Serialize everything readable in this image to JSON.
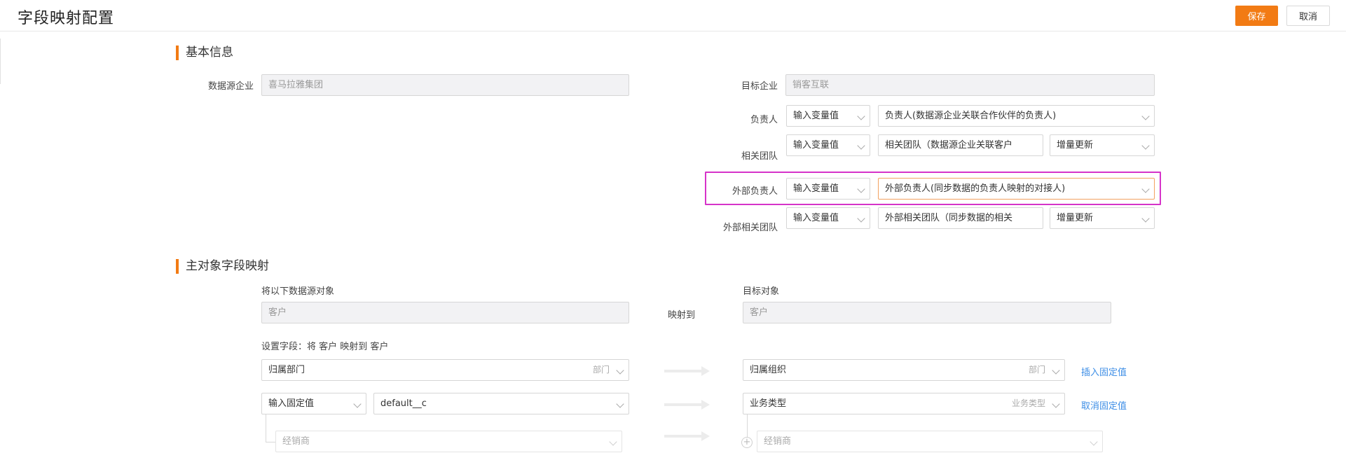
{
  "header": {
    "title": "字段映射配置",
    "save_label": "保存",
    "cancel_label": "取消"
  },
  "basic_info": {
    "section_title": "基本信息",
    "source_company_label": "数据源企业",
    "source_company_value": "喜马拉雅集团",
    "target_company_label": "目标企业",
    "target_company_value": "销客互联",
    "rows": [
      {
        "label": "负责人",
        "mode": "输入变量值",
        "value": "负责人(数据源企业关联合作伙伴的负责人)"
      },
      {
        "label": "相关团队",
        "mode": "输入变量值",
        "value": "相关团队（数据源企业关联客户",
        "update": "增量更新"
      },
      {
        "label": "外部负责人",
        "mode": "输入变量值",
        "value": "外部负责人(同步数据的负责人映射的对接人)"
      },
      {
        "label": "外部相关团队",
        "mode": "输入变量值",
        "value": "外部相关团队（同步数据的相关",
        "update": "增量更新"
      }
    ]
  },
  "mapping": {
    "section_title": "主对象字段映射",
    "source_object_label": "将以下数据源对象",
    "source_object_value": "客户",
    "map_to_label": "映射到",
    "target_object_label": "目标对象",
    "target_object_value": "客户",
    "set_fields_label": "设置字段：将 客户 映射到 客户",
    "rows": [
      {
        "source": "归属部门",
        "source_hint": "部门",
        "target": "归属组织",
        "target_hint": "部门",
        "action": "插入固定值"
      },
      {
        "source_mode": "输入固定值",
        "source": "default__c",
        "target": "业务类型",
        "target_hint": "业务类型",
        "action": "取消固定值"
      },
      {
        "source": "经销商",
        "target": "经销商"
      }
    ]
  },
  "colors": {
    "accent": "#f27b14",
    "highlight": "#d633c9",
    "link": "#3d8ee6"
  }
}
